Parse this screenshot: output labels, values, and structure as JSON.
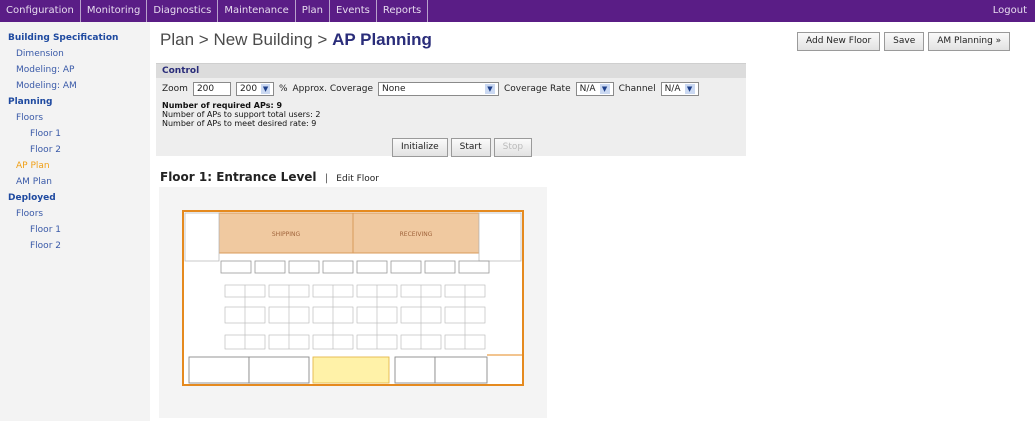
{
  "topnav": {
    "items": [
      "Configuration",
      "Monitoring",
      "Diagnostics",
      "Maintenance",
      "Plan",
      "Events",
      "Reports"
    ],
    "logout": "Logout"
  },
  "sidebar": {
    "building_spec": "Building Specification",
    "dimension": "Dimension",
    "modeling_ap": "Modeling: AP",
    "modeling_am": "Modeling: AM",
    "planning": "Planning",
    "floors": "Floors",
    "floor1": "Floor 1",
    "floor2": "Floor 2",
    "ap_plan": "AP Plan",
    "am_plan": "AM Plan",
    "deployed": "Deployed",
    "dep_floors": "Floors",
    "dep_floor1": "Floor 1",
    "dep_floor2": "Floor 2"
  },
  "breadcrumb": {
    "part1": "Plan",
    "sep": ">",
    "part2": "New Building",
    "current": "AP Planning"
  },
  "toolbar": {
    "add_floor": "Add New Floor",
    "save": "Save",
    "am_planning": "AM Planning »"
  },
  "control": {
    "title": "Control",
    "zoom_label": "Zoom",
    "zoom_value": "200",
    "zoom_select": "200",
    "percent": "%",
    "coverage_label": "Approx. Coverage",
    "coverage_value": "None",
    "rate_label": "Coverage Rate",
    "rate_value": "N/A",
    "channel_label": "Channel",
    "channel_value": "N/A",
    "required_aps": "Number of required APs: 9",
    "aps_users": "Number of APs to support total users: 2",
    "aps_rate": "Number of APs to meet desired rate: 9",
    "initialize": "Initialize",
    "start": "Start",
    "stop": "Stop"
  },
  "floor": {
    "title": "Floor 1: Entrance Level",
    "sep": "|",
    "edit": "Edit Floor",
    "room_left": "SHIPPING",
    "room_right": "RECEIVING"
  },
  "colors": {
    "nav": "#5a1d86",
    "accent": "#f0a018",
    "link": "#3a5aa8",
    "room_fill": "#f0c9a0",
    "highlight": "#fff2a8"
  }
}
